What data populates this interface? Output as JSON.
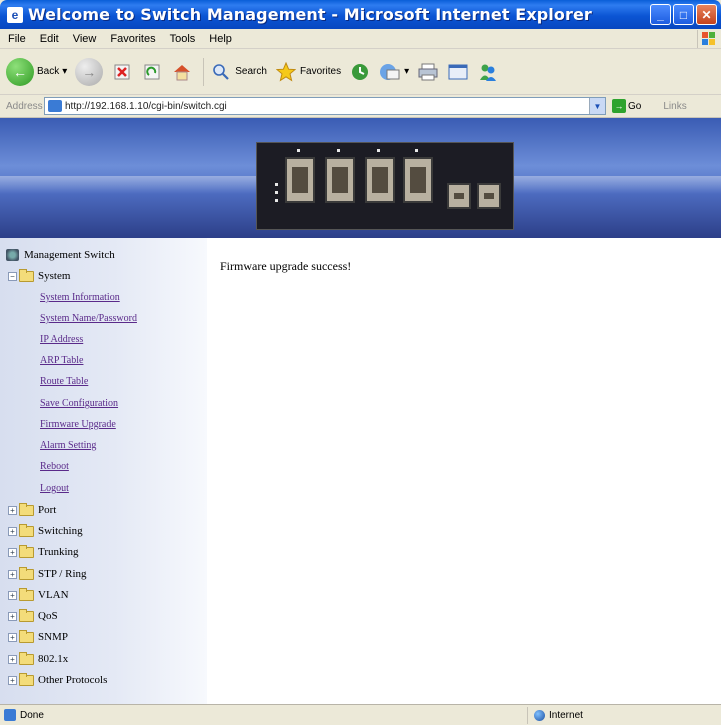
{
  "window": {
    "title": "Welcome to Switch Management - Microsoft Internet Explorer",
    "app_icon": "ie-page-icon",
    "buttons": {
      "minimize": "_",
      "maximize": "□",
      "close": "✕"
    }
  },
  "menu": [
    {
      "label": "File"
    },
    {
      "label": "Edit"
    },
    {
      "label": "View"
    },
    {
      "label": "Favorites"
    },
    {
      "label": "Tools"
    },
    {
      "label": "Help"
    }
  ],
  "toolbar": {
    "back_label": "Back",
    "search_label": "Search",
    "favorites_label": "Favorites"
  },
  "address": {
    "label": "Address",
    "url": "http://192.168.1.10/cgi-bin/switch.cgi",
    "go_label": "Go",
    "links_label": "Links"
  },
  "sidebar": {
    "root": "Management Switch",
    "system": {
      "label": "System",
      "items": [
        "System Information",
        "System Name/Password",
        "IP Address",
        "ARP Table",
        "Route Table",
        "Save Configuration",
        "Firmware Upgrade",
        "Alarm Setting",
        "Reboot",
        "Logout"
      ]
    },
    "groups": [
      "Port",
      "Switching",
      "Trunking",
      "STP / Ring",
      "VLAN",
      "QoS",
      "SNMP",
      "802.1x",
      "Other Protocols"
    ]
  },
  "content": {
    "message": "Firmware upgrade success!"
  },
  "status": {
    "left": "Done",
    "zone": "Internet"
  }
}
